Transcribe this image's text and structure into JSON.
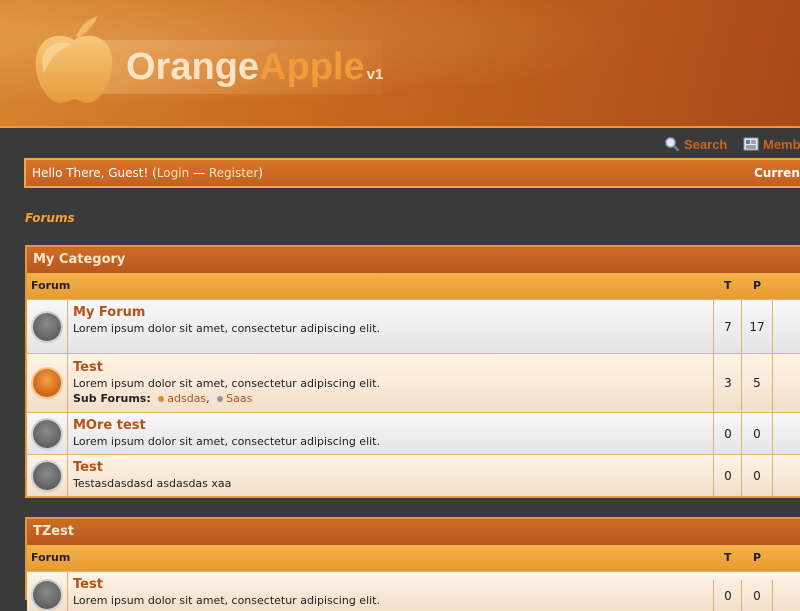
{
  "header": {
    "logo_orange": "Orange",
    "logo_apple": "Apple",
    "logo_version": "v1",
    "logo_icon": "apple-logo-icon"
  },
  "toplinks": {
    "search": "Search",
    "members": "Member"
  },
  "welcome": {
    "greeting": "Hello There, Guest!",
    "login": "Login",
    "separator": "—",
    "register": "Register",
    "current": "Current"
  },
  "breadcrumb": "Forums",
  "colors": {
    "accent": "#c8651f",
    "header_bg": "#c8691f",
    "column_header_bg": "#e89b2f",
    "link": "#b4521a",
    "page_bg": "#3a3a3a"
  },
  "categories": [
    {
      "title": "My Category",
      "col_forum": "Forum",
      "col_threads": "T",
      "col_posts": "P",
      "forums": [
        {
          "name": "My Forum",
          "desc": "Lorem ipsum dolor sit amet, consectetur adipiscing elit.",
          "threads": "7",
          "posts": "17",
          "status": "off"
        },
        {
          "name": "Test",
          "desc": "Lorem ipsum dolor sit amet, consectetur adipiscing elit.",
          "threads": "3",
          "posts": "5",
          "status": "on",
          "subforums_label": "Sub Forums:",
          "subforums": [
            {
              "name": "adsdas",
              "status": "on"
            },
            {
              "name": "Saas",
              "status": "off"
            }
          ]
        },
        {
          "name": "MOre test",
          "desc": "Lorem ipsum dolor sit amet, consectetur adipiscing elit.",
          "threads": "0",
          "posts": "0",
          "status": "off"
        },
        {
          "name": "Test",
          "desc": "Testasdasdasd asdasdas xaa",
          "threads": "0",
          "posts": "0",
          "status": "off"
        }
      ]
    },
    {
      "title": "TZest",
      "col_forum": "Forum",
      "col_threads": "T",
      "col_posts": "P",
      "forums": [
        {
          "name": "Test",
          "desc": "Lorem ipsum dolor sit amet, consectetur adipiscing elit.",
          "threads": "0",
          "posts": "0",
          "status": "off"
        }
      ]
    }
  ]
}
